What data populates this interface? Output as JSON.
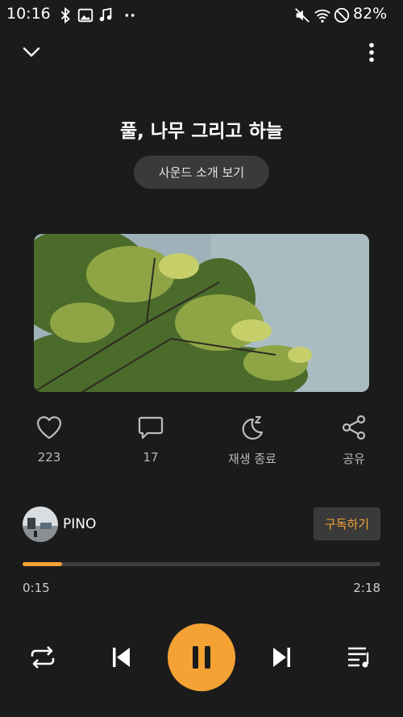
{
  "status_bar": {
    "time": "10:16",
    "battery": "82%",
    "icons": [
      "bluetooth-icon",
      "image-icon",
      "music-note-icon",
      "more-dots-icon",
      "mute-icon",
      "wifi-icon",
      "do-not-disturb-icon"
    ]
  },
  "header": {
    "collapse_icon": "chevron-down-icon",
    "more_icon": "more-vertical-icon"
  },
  "track": {
    "title": "풀, 나무 그리고 하늘",
    "intro_button": "사운드 소개 보기"
  },
  "actions": [
    {
      "icon": "heart-icon",
      "label": "223"
    },
    {
      "icon": "comment-icon",
      "label": "17"
    },
    {
      "icon": "sleep-timer-icon",
      "label": "재생 종료"
    },
    {
      "icon": "share-icon",
      "label": "공유"
    }
  ],
  "channel": {
    "name": "PINO",
    "subscribe_label": "구독하기"
  },
  "player": {
    "current_time": "0:15",
    "total_time": "2:18",
    "progress_fraction": 0.11,
    "controls": [
      "repeat-icon",
      "previous-icon",
      "pause-icon",
      "next-icon",
      "playlist-icon"
    ]
  },
  "colors": {
    "accent": "#f5a234",
    "background": "#1b1b1b",
    "button_bg": "#3a3a3a"
  }
}
